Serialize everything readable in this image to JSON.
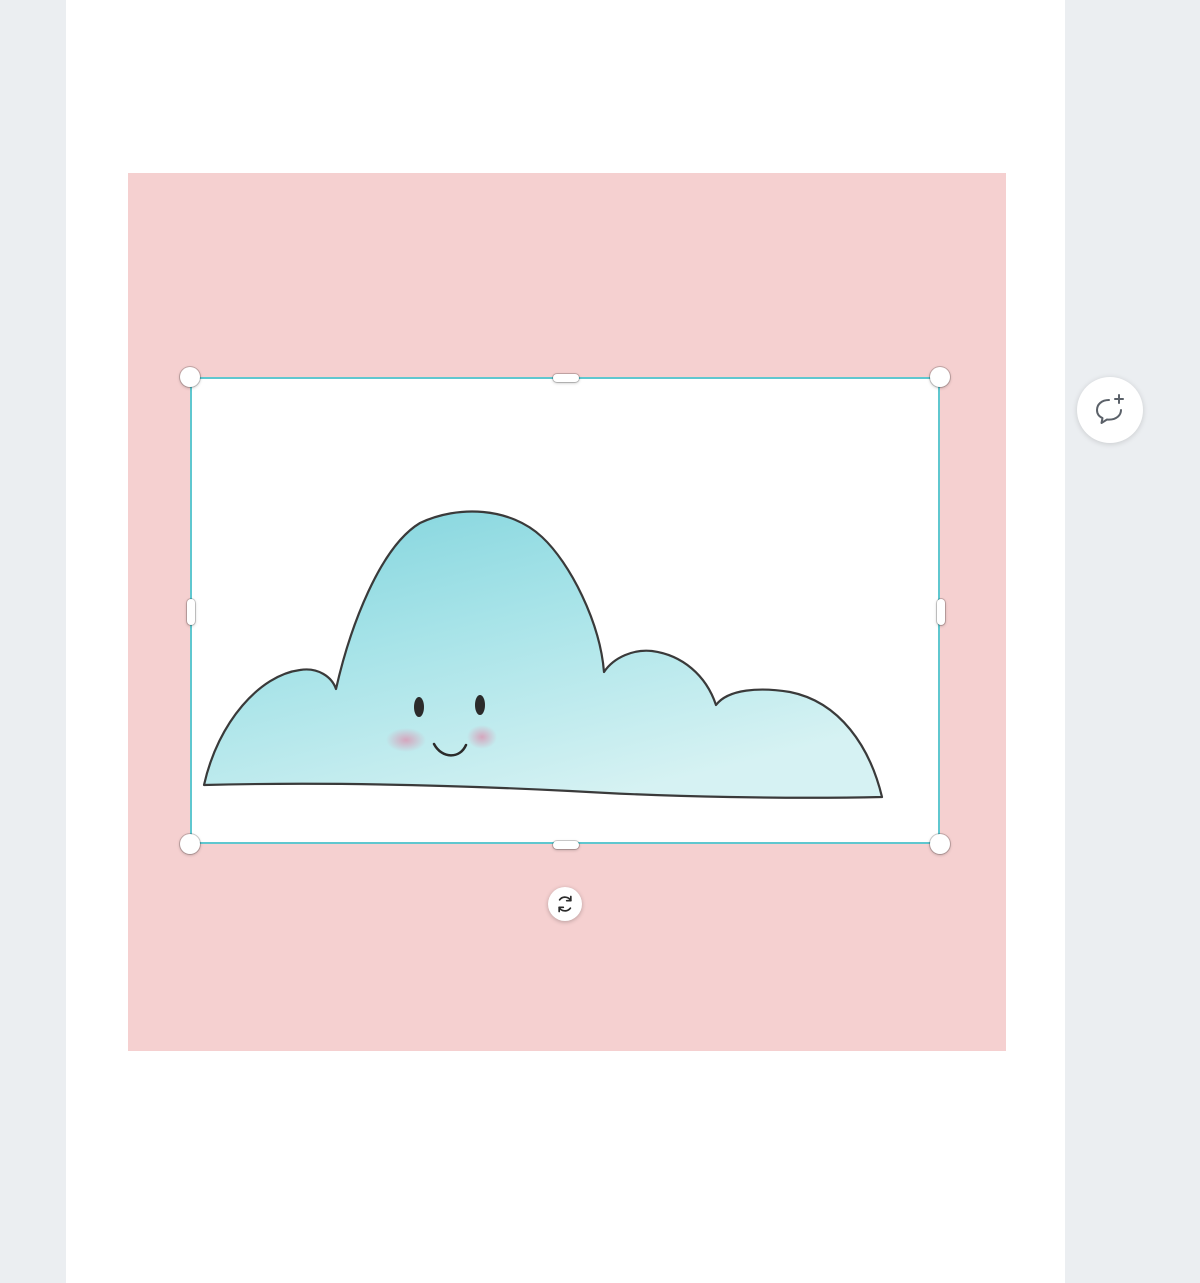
{
  "canvas": {
    "background_color": "#ebeef1",
    "page_color": "#ffffff",
    "square_color": "#f5d0d0"
  },
  "selection": {
    "border_color": "#5fc7cf",
    "element_name": "cloud-illustration-image"
  },
  "icons": {
    "rotate": "rotate-icon",
    "comment": "add-comment-icon"
  }
}
